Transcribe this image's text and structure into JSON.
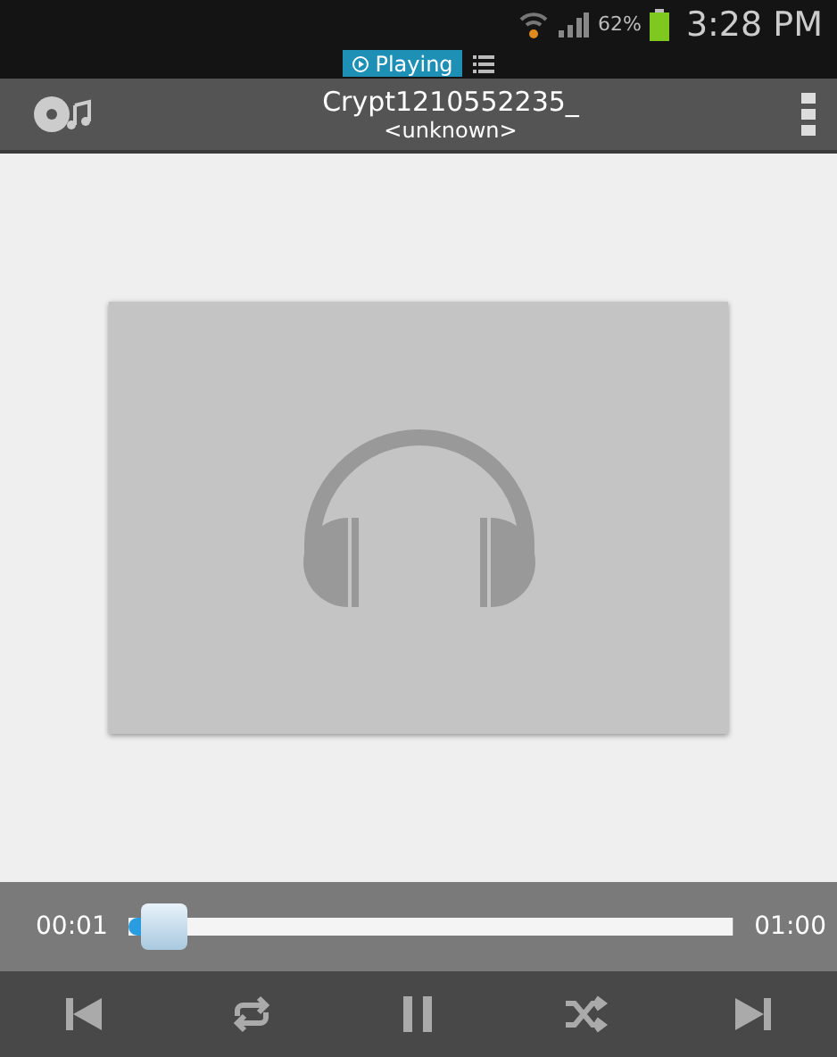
{
  "status_bar": {
    "battery": "62%",
    "time": "3:28 PM"
  },
  "notification": {
    "label": "Playing"
  },
  "title_bar": {
    "title": "Crypt1210552235_",
    "subtitle": "<unknown>"
  },
  "seek": {
    "elapsed": "00:01",
    "total": "01:00",
    "level": 0.02
  },
  "controls": [
    {
      "kind": "previous"
    },
    {
      "kind": "repeat"
    },
    {
      "kind": "pause"
    },
    {
      "kind": "shuffle"
    },
    {
      "kind": "next"
    }
  ]
}
